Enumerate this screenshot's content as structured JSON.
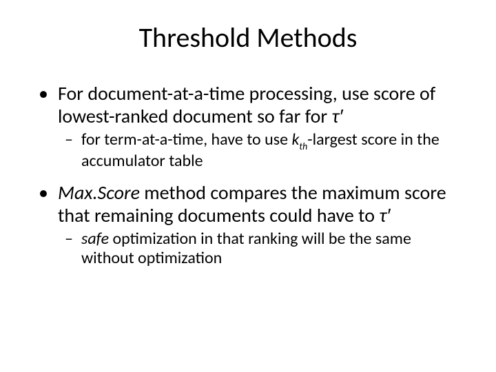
{
  "slide": {
    "title": "Threshold Methods",
    "b1": {
      "pre": "For document-at-a-time processing, use score of lowest-ranked document so far for ",
      "tau": "τ′",
      "s1": {
        "a": "for term-at-a-time, have to use ",
        "k": "k",
        "th": "th",
        "b": "-largest score in the accumulator table"
      }
    },
    "b2": {
      "ms": "Max.Score",
      "rest": " method compares the maximum score that remaining documents could have to ",
      "tau": "τ′",
      "s1": {
        "safe": "safe",
        "rest": " optimization in that ranking will be the same without optimization"
      }
    }
  }
}
